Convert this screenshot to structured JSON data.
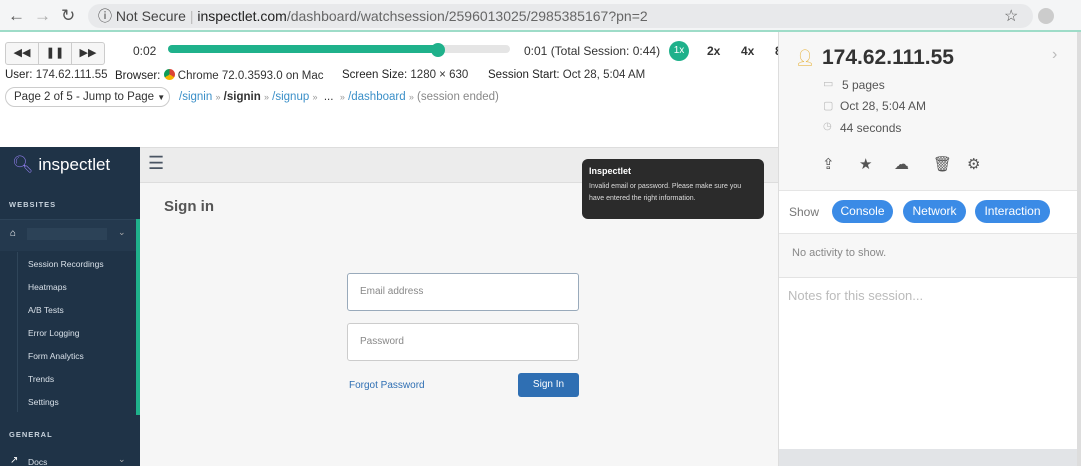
{
  "browser": {
    "not_secure": "Not Secure",
    "url_host": "inspectlet.com",
    "url_path": "/dashboard/watchsession/2596013025/2985385167?pn=2"
  },
  "player": {
    "elapsed": "0:02",
    "remaining": "0:01 (Total Session: 0:44)",
    "progress_fraction": 0.79,
    "speeds": [
      "1x",
      "2x",
      "4x",
      "8"
    ],
    "accent": "#1fb18b"
  },
  "meta": {
    "user_label": "User:",
    "user": "174.62.111.55",
    "browser_label": "Browser:",
    "browser": "Chrome 72.0.3593.0 on Mac",
    "screen_label": "Screen Size:",
    "screen": "1280 × 630",
    "start_label": "Session Start:",
    "start": "Oct 28, 5:04 AM"
  },
  "nav": {
    "jump": "Page 2 of 5 - Jump to Page",
    "crumbs": [
      "/signin",
      "/signin",
      "/signup",
      "...",
      "/dashboard",
      "(session ended)"
    ]
  },
  "app": {
    "logo": "inspectlet",
    "websites": "WEBSITES",
    "items": [
      "Session Recordings",
      "Heatmaps",
      "A/B Tests",
      "Error Logging",
      "Form Analytics",
      "Trends",
      "Settings"
    ],
    "general": "GENERAL",
    "docs": "Docs",
    "title": "Sign in",
    "email_placeholder": "Email address",
    "password_placeholder": "Password",
    "forgot": "Forgot Password",
    "signin_btn": "Sign In",
    "toast_title": "Inspectlet",
    "toast_msg": "Invalid email or password. Please make sure you have entered the right information."
  },
  "panel": {
    "ip": "174.62.111.55",
    "pages": "5 pages",
    "date": "Oct 28, 5:04 AM",
    "duration": "44 seconds",
    "show": "Show",
    "filters": [
      "Console",
      "Network",
      "Interaction"
    ],
    "no_activity": "No activity to show.",
    "notes_placeholder": "Notes for this session..."
  }
}
